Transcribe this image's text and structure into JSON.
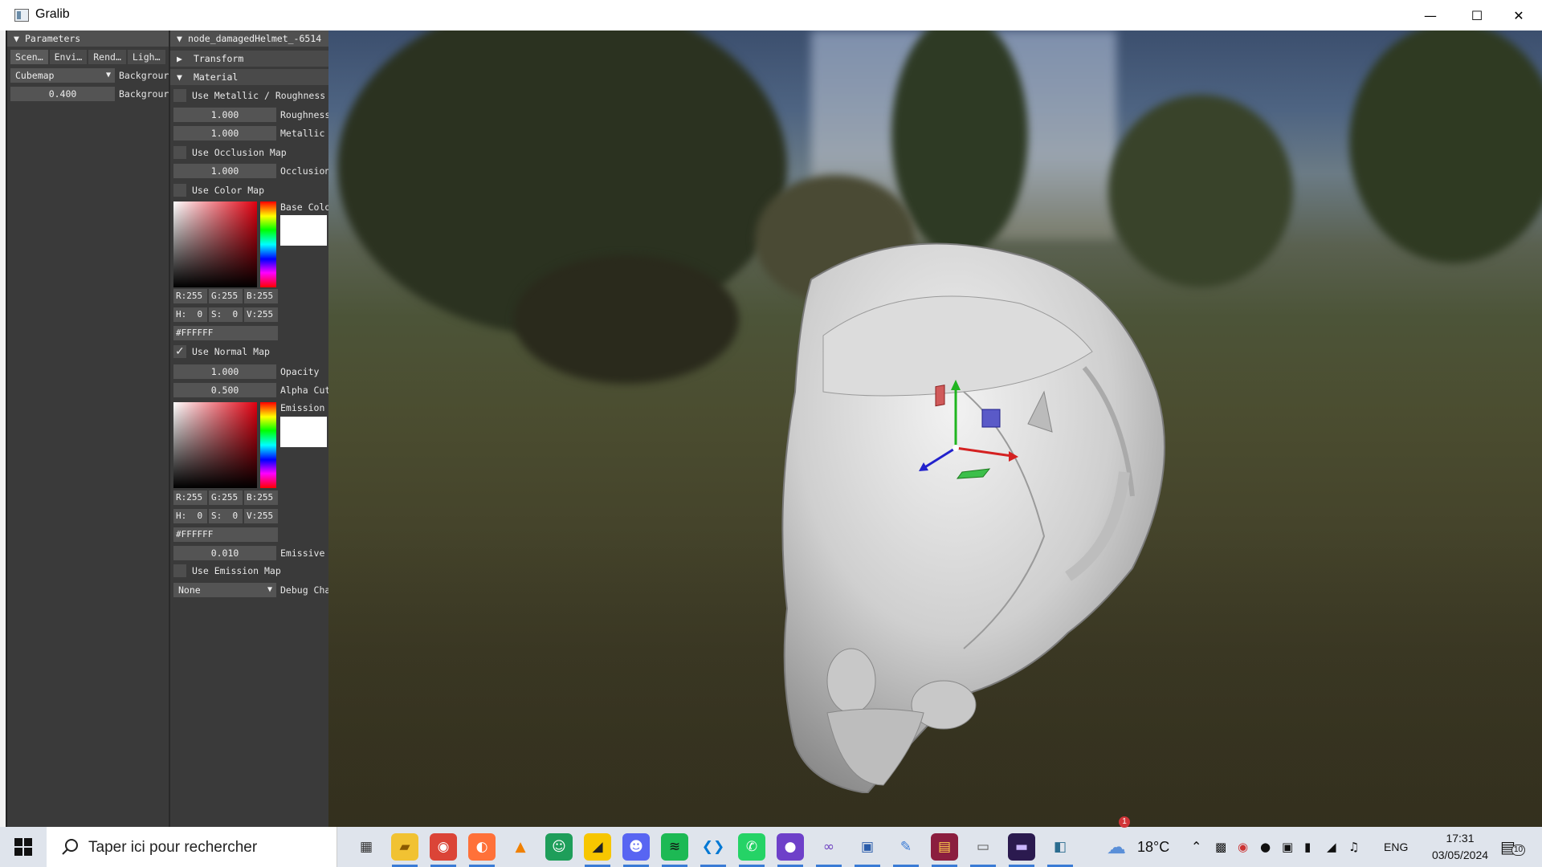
{
  "window": {
    "title": "Gralib"
  },
  "params_panel": {
    "header": "Parameters",
    "tabs": [
      "Scen…",
      "Envi…",
      "Rend…",
      "Ligh…"
    ],
    "background_combo": "Cubemap",
    "background_label_1": "Backgrour",
    "intensity_value": "0.400",
    "background_label_2": "Backgrour"
  },
  "node_panel": {
    "header": "node_damagedHelmet_-6514",
    "transform_header": "Transform",
    "material_header": "Material",
    "use_metallic_roughness": {
      "label": "Use Metallic / Roughness",
      "checked": false
    },
    "roughness": {
      "value": "1.000",
      "label": "Roughness"
    },
    "metallic": {
      "value": "1.000",
      "label": "Metallic"
    },
    "use_occlusion_map": {
      "label": "Use Occlusion Map",
      "checked": false
    },
    "occlusion": {
      "value": "1.000",
      "label": "Occlusion"
    },
    "use_color_map": {
      "label": "Use Color Map",
      "checked": false
    },
    "base_color": {
      "label": "Base Colo",
      "swatch": "#FFFFFF",
      "r": "R:255",
      "g": "G:255",
      "b": "B:255",
      "h": "H:  0",
      "s": "S:  0",
      "v": "V:255",
      "hex": "#FFFFFF"
    },
    "use_normal_map": {
      "label": "Use Normal Map",
      "checked": true
    },
    "opacity": {
      "value": "1.000",
      "label": "Opacity"
    },
    "alpha_cutoff": {
      "value": "0.500",
      "label": "Alpha Cut"
    },
    "emission_color": {
      "label": "Emission",
      "swatch": "#FFFFFF",
      "r": "R:255",
      "g": "G:255",
      "b": "B:255",
      "h": "H:  0",
      "s": "S:  0",
      "v": "V:255",
      "hex": "#FFFFFF"
    },
    "emissive": {
      "value": "0.010",
      "label": "Emissive"
    },
    "use_emission_map": {
      "label": "Use Emission Map",
      "checked": false
    },
    "debug_channel": {
      "value": "None",
      "label": "Debug Cha"
    }
  },
  "taskbar": {
    "search_placeholder": "Taper ici pour rechercher",
    "weather": "18°C",
    "weather_badge": "1",
    "language": "ENG",
    "time": "17:31",
    "date": "03/05/2024",
    "notifications": "10",
    "apps": [
      {
        "name": "task-view-icon",
        "glyph": "▦",
        "bg": "#dfe4ec",
        "fg": "#333",
        "active": false
      },
      {
        "name": "file-explorer-icon",
        "glyph": "▰",
        "bg": "#f1c232",
        "fg": "#8a5a00",
        "active": true
      },
      {
        "name": "chrome-icon",
        "glyph": "◉",
        "bg": "#db4437",
        "fg": "#fff",
        "active": true
      },
      {
        "name": "firefox-icon",
        "glyph": "◐",
        "bg": "#ff7139",
        "fg": "#fff",
        "active": true
      },
      {
        "name": "vlc-icon",
        "glyph": "▲",
        "bg": "#dfe4ec",
        "fg": "#f08000",
        "active": false
      },
      {
        "name": "contacts-icon",
        "glyph": "☺",
        "bg": "#1e9e5a",
        "fg": "#fff",
        "active": false
      },
      {
        "name": "sticky-notes-icon",
        "glyph": "◢",
        "bg": "#f7c600",
        "fg": "#222",
        "active": true
      },
      {
        "name": "discord-icon",
        "glyph": "☻",
        "bg": "#5865f2",
        "fg": "#fff",
        "active": true
      },
      {
        "name": "spotify-icon",
        "glyph": "≋",
        "bg": "#1db954",
        "fg": "#111",
        "active": true
      },
      {
        "name": "vscode-icon",
        "glyph": "❮❯",
        "bg": "#dfe4ec",
        "fg": "#0078d4",
        "active": true
      },
      {
        "name": "whatsapp-icon",
        "glyph": "✆",
        "bg": "#25d366",
        "fg": "#fff",
        "active": true
      },
      {
        "name": "github-icon",
        "glyph": "●",
        "bg": "#6e40c9",
        "fg": "#fff",
        "active": true
      },
      {
        "name": "visual-studio-icon",
        "glyph": "∞",
        "bg": "#dfe4ec",
        "fg": "#6f42c1",
        "active": true
      },
      {
        "name": "network-share-icon",
        "glyph": "▣",
        "bg": "#dfe4ec",
        "fg": "#2a5caa",
        "active": true
      },
      {
        "name": "paint-icon",
        "glyph": "✎",
        "bg": "#dfe4ec",
        "fg": "#3a7bd5",
        "active": true
      },
      {
        "name": "winrar-icon",
        "glyph": "▤",
        "bg": "#8b1e3f",
        "fg": "#ffd24d",
        "active": true
      },
      {
        "name": "image-viewer-icon",
        "glyph": "▭",
        "bg": "#dfe4ec",
        "fg": "#555",
        "active": true
      },
      {
        "name": "terminal-icon",
        "glyph": "▬",
        "bg": "#2b1a4f",
        "fg": "#cbb6ff",
        "active": true
      },
      {
        "name": "gralib-app-icon",
        "glyph": "◧",
        "bg": "#dfe4ec",
        "fg": "#2b6c8f",
        "active": true
      }
    ]
  }
}
